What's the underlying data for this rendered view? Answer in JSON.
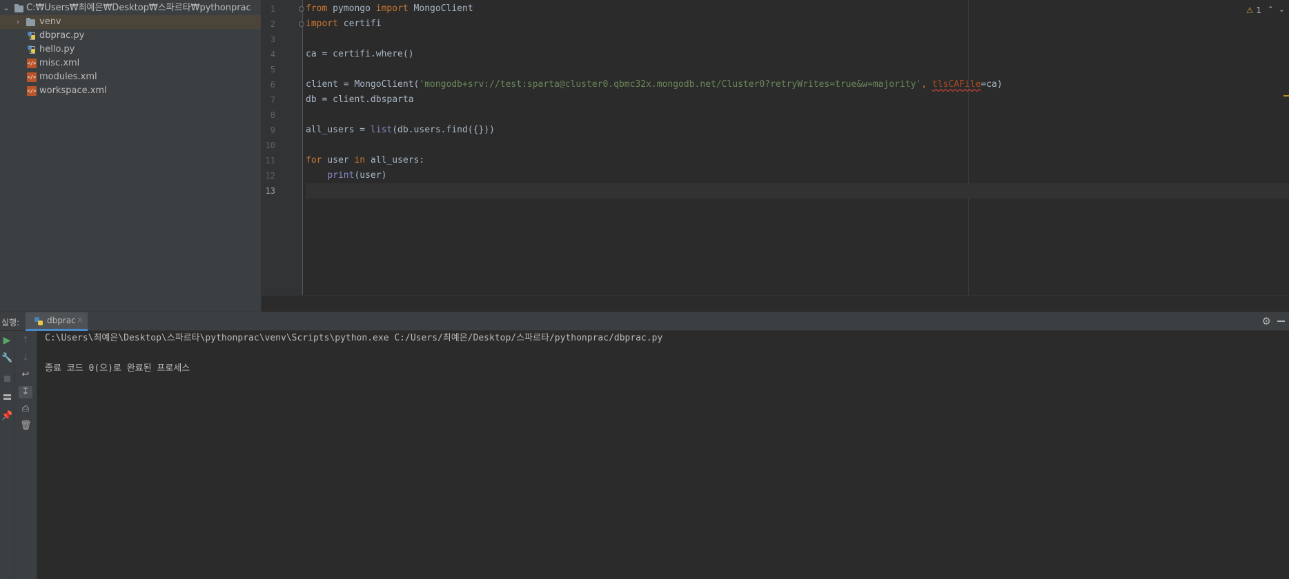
{
  "project_tree": {
    "root_label": "C:₩Users₩최예은₩Desktop₩스파르타₩pythonprac",
    "items": [
      {
        "label": "venv",
        "icon": "folder-icon"
      },
      {
        "label": "dbprac.py",
        "icon": "python-file-icon"
      },
      {
        "label": "hello.py",
        "icon": "python-file-icon"
      },
      {
        "label": "misc.xml",
        "icon": "xml-file-icon"
      },
      {
        "label": "modules.xml",
        "icon": "xml-file-icon"
      },
      {
        "label": "workspace.xml",
        "icon": "xml-file-icon"
      }
    ]
  },
  "editor": {
    "warning_count": "1",
    "line_numbers": [
      "1",
      "2",
      "3",
      "4",
      "5",
      "6",
      "7",
      "8",
      "9",
      "10",
      "11",
      "12",
      "13"
    ],
    "current_line": "13",
    "code": {
      "l1_kw1": "from",
      "l1_mod": " pymongo ",
      "l1_kw2": "import",
      "l1_name": " MongoClient",
      "l2_kw": "import",
      "l2_mod": " certifi",
      "l4": "ca = certifi.where()",
      "l6_a": "client = MongoClient(",
      "l6_str": "'mongodb+srv://test:sparta@cluster0.qbmc32x.mongodb.net/Cluster0?retryWrites=true&w=majority'",
      "l6_comma": ", ",
      "l6_param": "tlsCAFile",
      "l6_end": "=ca)",
      "l7": "db = client.dbsparta",
      "l9_a": "all_users = ",
      "l9_bi": "list",
      "l9_b": "(db.users.find({}))",
      "l11_kw1": "for",
      "l11_a": " user ",
      "l11_kw2": "in",
      "l11_b": " all_users:",
      "l12_indent": "    ",
      "l12_bi": "print",
      "l12_b": "(user)"
    }
  },
  "run_panel": {
    "label": "실행:",
    "tab_label": "dbprac",
    "console_lines": [
      "C:\\Users\\최예은\\Desktop\\스파르타\\pythonprac\\venv\\Scripts\\python.exe C:/Users/최예은/Desktop/스파르타/pythonprac/dbprac.py",
      "",
      "종료 코드 0(으)로 완료된 프로세스"
    ]
  },
  "colors": {
    "keyword": "#cc7832",
    "string": "#6a8759",
    "builtin": "#8888c6",
    "text": "#a9b7c6",
    "run_green": "#59a869"
  }
}
